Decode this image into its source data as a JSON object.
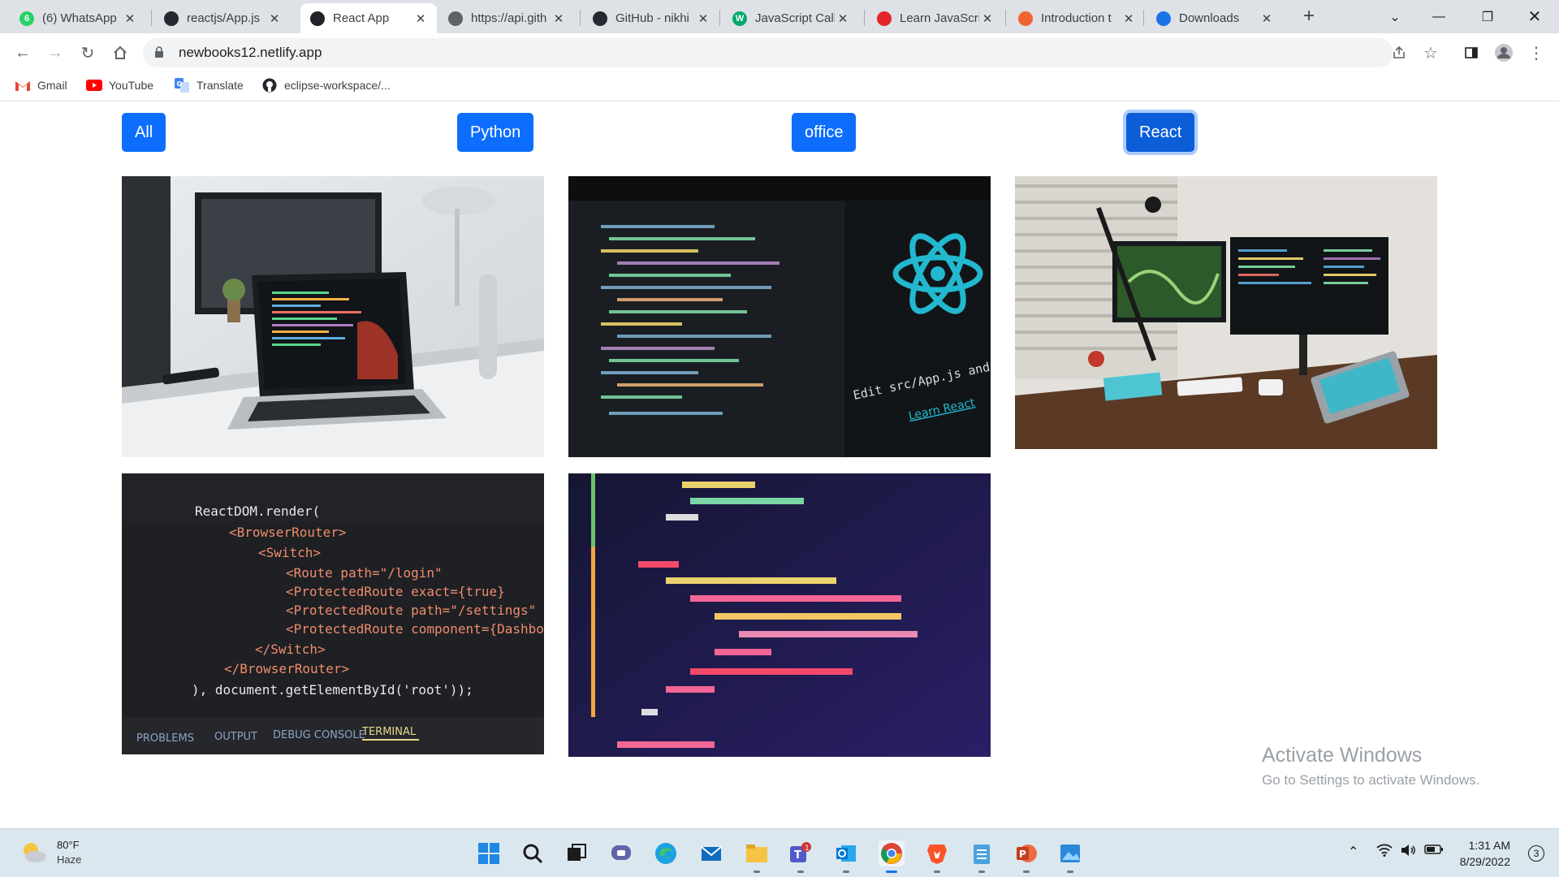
{
  "browser": {
    "tabs": [
      {
        "title": "(6) WhatsApp",
        "icon": "whatsapp-icon",
        "color": "#25d366",
        "badge": "6"
      },
      {
        "title": "reactjs/App.js",
        "icon": "github-icon",
        "color": "#24292f",
        "badge": ""
      },
      {
        "title": "React App",
        "icon": "react-icon",
        "color": "#20232a",
        "badge": ""
      },
      {
        "title": "https://api.gith",
        "icon": "globe-icon",
        "color": "#5f6368",
        "badge": ""
      },
      {
        "title": "GitHub - nikhi",
        "icon": "github-icon",
        "color": "#24292f",
        "badge": ""
      },
      {
        "title": "JavaScript Call",
        "icon": "w3schools-icon",
        "color": "#04aa6d",
        "badge": "W"
      },
      {
        "title": "Learn JavaScri",
        "icon": "vivaldi-icon",
        "color": "#e3262c",
        "badge": ""
      },
      {
        "title": "Introduction t",
        "icon": "html5-icon",
        "color": "#f0652f",
        "badge": ""
      },
      {
        "title": "Downloads",
        "icon": "download-icon",
        "color": "#1a73e8",
        "badge": ""
      }
    ],
    "active_tab_index": 2,
    "address": "newbooks12.netlify.app",
    "bookmarks": [
      {
        "label": "Gmail",
        "icon": "gmail-icon"
      },
      {
        "label": "YouTube",
        "icon": "youtube-icon"
      },
      {
        "label": "Translate",
        "icon": "translate-icon"
      },
      {
        "label": "eclipse-workspace/...",
        "icon": "github-icon"
      }
    ]
  },
  "page": {
    "filters": [
      {
        "label": "All",
        "active": false
      },
      {
        "label": "Python",
        "active": false
      },
      {
        "label": "office",
        "active": false
      },
      {
        "label": "React",
        "active": true
      }
    ],
    "gallery": [
      {
        "name": "laptop-desk-image",
        "alt": "laptop on white desk"
      },
      {
        "name": "react-code-screen-image",
        "alt": "react logo on monitor"
      },
      {
        "name": "dual-monitor-setup-image",
        "alt": "desk with monitors"
      },
      {
        "name": "reactdom-code-image",
        "alt": "ReactDOM code editor"
      },
      {
        "name": "jsx-code-image",
        "alt": "colorful jsx code"
      }
    ],
    "code_snippet_1": {
      "lines": [
        "ReactDOM.render(",
        "<BrowserRouter>",
        "<Switch>",
        "<Route path=\"/login\"",
        "<ProtectedRoute exact={true}",
        "<ProtectedRoute path=\"/settings\"",
        "<ProtectedRoute component={Dashboard}",
        "</Switch>",
        "</BrowserRouter>",
        "), document.getElementById('root'));"
      ],
      "tabs": [
        "PROBLEMS",
        "OUTPUT",
        "DEBUG CONSOLE",
        "TERMINAL"
      ]
    },
    "react_screen_caption": "Edit src/App.js and save to reload.",
    "react_screen_link": "Learn React"
  },
  "watermark": {
    "line1": "Activate Windows",
    "line2": "Go to Settings to activate Windows."
  },
  "taskbar": {
    "temperature": "80°F",
    "condition": "Haze",
    "time": "1:31 AM",
    "date": "8/29/2022",
    "notification_count": "3",
    "teams_badge": "1"
  },
  "colors": {
    "primary": "#0d6efd",
    "primary_active": "#0b5ed7",
    "tabstrip": "#dee1e6"
  }
}
